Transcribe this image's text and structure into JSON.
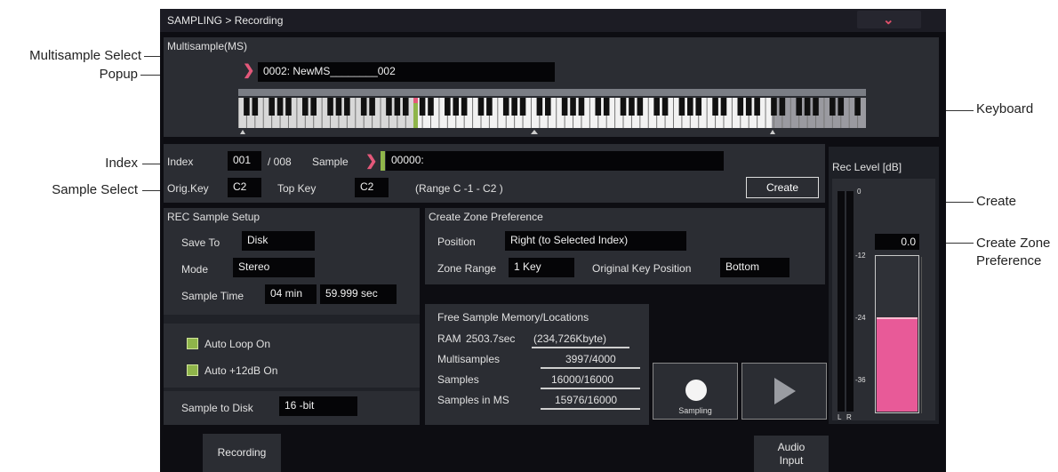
{
  "callouts": {
    "multisample_select_line1": "Multisample Select",
    "multisample_select_line2": "Popup",
    "index": "Index",
    "sample_select": "Sample Select",
    "keyboard": "Keyboard",
    "create": "Create",
    "create_zone_line1": "Create Zone",
    "create_zone_line2": "Preference"
  },
  "header": {
    "breadcrumb": "SAMPLING > Recording",
    "menu_icon": "chevron-down-icon"
  },
  "multisample": {
    "section_label": "Multisample(MS)",
    "name_value": "0002: NewMS________002"
  },
  "index_row": {
    "index_label": "Index",
    "index_value": "001",
    "index_sep": "/ 008",
    "sample_label": "Sample",
    "sample_value": "00000:",
    "orig_key_label": "Orig.Key",
    "orig_key_value": "C2",
    "top_key_label": "Top Key",
    "top_key_value": "C2",
    "range_text": "(Range  C -1    -  C2    )",
    "create_button": "Create"
  },
  "rec_setup": {
    "title": "REC Sample Setup",
    "save_to_label": "Save To",
    "save_to_value": "Disk",
    "mode_label": "Mode",
    "mode_value": "Stereo",
    "sample_time_label": "Sample Time",
    "sample_time_min": "04 min",
    "sample_time_sec": "59.999 sec",
    "auto_loop": "Auto Loop On",
    "auto_12db": "Auto +12dB On",
    "sample_to_disk_label": "Sample to Disk",
    "sample_to_disk_value": "16 -bit"
  },
  "zone_pref": {
    "title": "Create Zone Preference",
    "position_label": "Position",
    "position_value": "Right (to Selected Index)",
    "zone_range_label": "Zone Range",
    "zone_range_value": "1 Key",
    "orig_key_pos_label": "Original Key Position",
    "orig_key_pos_value": "Bottom"
  },
  "memory": {
    "title": "Free Sample Memory/Locations",
    "ram_label": "RAM",
    "ram_value": "2503.7sec",
    "ram_kbyte": "(234,726Kbyte)",
    "multisamples_label": "Multisamples",
    "multisamples_value": "3997/4000",
    "samples_label": "Samples",
    "samples_value": "16000/16000",
    "samples_in_ms_label": "Samples in MS",
    "samples_in_ms_value": "15976/16000"
  },
  "transport": {
    "sampling_label": "Sampling",
    "record_icon": "record-circle-icon",
    "play_icon": "play-icon"
  },
  "rec_level": {
    "title": "Rec Level [dB]",
    "value": "0.0",
    "tick_0": "0",
    "tick_12": "-12",
    "tick_24": "-24",
    "tick_36": "-36",
    "ch_l": "L",
    "ch_r": "R",
    "level_fraction": 0.6
  },
  "tabs": {
    "recording": "Recording",
    "audio_line1": "Audio",
    "audio_line2": "Input"
  },
  "colors": {
    "accent_pink": "#e4587a",
    "meter_pink": "#e85a98",
    "checkbox_green": "#8fb54a",
    "sample_marker_green": "#8fb54a"
  }
}
